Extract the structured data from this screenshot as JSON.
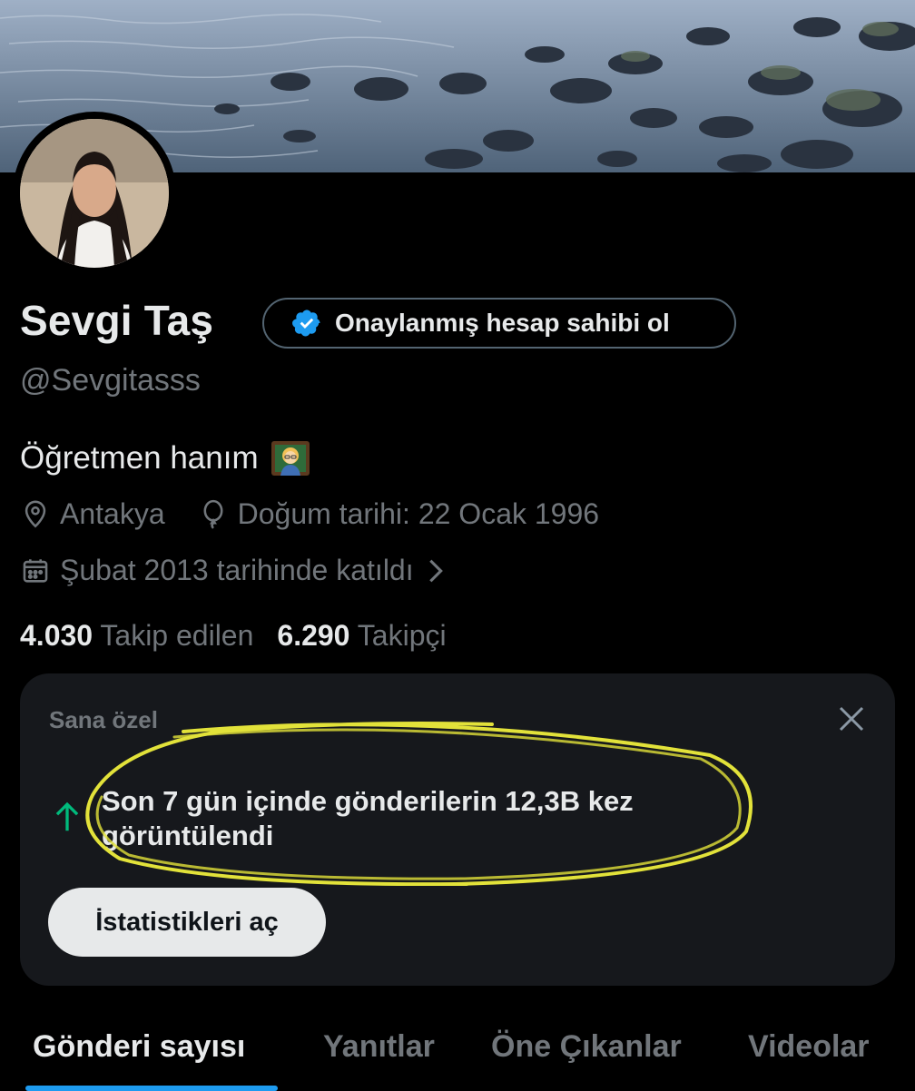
{
  "profile": {
    "name": "Sevgi Taş",
    "handle": "@Sevgitasss",
    "verify_button_label": "Onaylanmış hesap sahibi ol",
    "bio": "Öğretmen hanım",
    "bio_emoji": "👩‍🏫",
    "location": "Antakya",
    "birthday": "Doğum tarihi: 22 Ocak 1996",
    "joined": "Şubat 2013 tarihinde katıldı",
    "following_count": "4.030",
    "following_label": "Takip edilen",
    "followers_count": "6.290",
    "followers_label": "Takipçi"
  },
  "insight_card": {
    "label": "Sana özel",
    "message": "Son 7 gün içinde gönderilerin 12,3B kez görüntülendi",
    "button_label": "İstatistikleri aç",
    "arrow_color": "#00ba7c",
    "highlight_color": "#e2e23a"
  },
  "tabs": [
    {
      "label": "Gönderi sayısı",
      "active": true
    },
    {
      "label": "Yanıtlar",
      "active": false
    },
    {
      "label": "Öne Çıkanlar",
      "active": false
    },
    {
      "label": "Videolar",
      "active": false
    }
  ],
  "colors": {
    "accent": "#1d9bf0",
    "background": "#000000",
    "muted_text": "#71767b",
    "card_bg": "#16181c"
  },
  "icons": [
    "verified-badge-icon",
    "location-pin-icon",
    "balloon-icon",
    "calendar-icon",
    "chevron-right-icon",
    "close-icon",
    "arrow-up-icon"
  ]
}
